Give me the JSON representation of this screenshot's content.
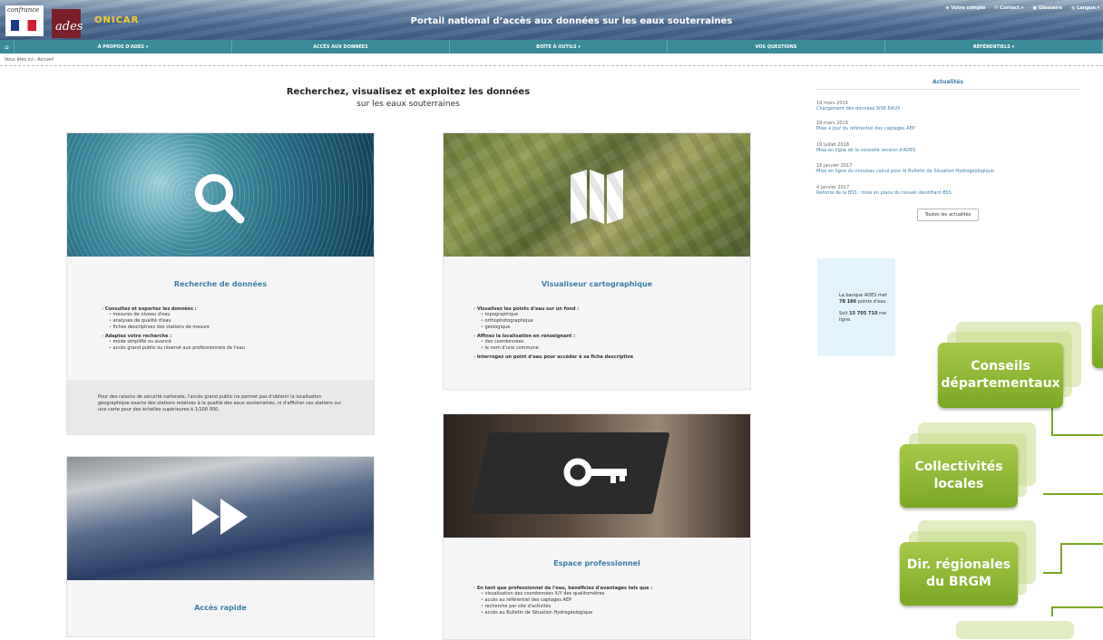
{
  "header": {
    "logo_france": "confrance",
    "logo_ades": "ades",
    "logo_onicar": "ONICAR",
    "portal_title": "Portail national d’accès aux données sur les eaux souterraines",
    "util": [
      "Votre compte",
      "Contact ▾",
      "Glossaire",
      "Langue ▾"
    ]
  },
  "nav": {
    "items": [
      "À PROPOS D'ADES ▾",
      "ACCÈS AUX DONNÉES",
      "BOÎTE À OUTILS ▾",
      "VOS QUESTIONS",
      "RÉFÉRENTIELS ▾"
    ]
  },
  "breadcrumb": "Vous êtes ici : Accueil",
  "main": {
    "title": "Recherchez, visualisez et exploitez les données",
    "subtitle": "sur les eaux souterraines"
  },
  "cards": {
    "recherche": {
      "title": "Recherche de données",
      "g1": "Consultez et exportez les données :",
      "g1_items": [
        "mesures de niveau d'eau",
        "analyses de qualité d'eau",
        "fiches descriptives des stations de mesure"
      ],
      "g2": "Adaptez votre recherche :",
      "g2_items": [
        "mode simplifié ou avancé",
        "accès grand public ou réservé aux professionnels de l'eau"
      ],
      "note": "Pour des raisons de sécurité nationale, l'accès grand public ne permet pas d'obtenir la localisation géographique exacte des stations relatives à la qualité des eaux souterraines, ni d'afficher ces stations sur une carte pour des échelles supérieures à 1/100 000."
    },
    "visu": {
      "title": "Visualiseur cartographique",
      "g1": "Visualisez les points d'eau sur un fond :",
      "g1_items": [
        "topographique",
        "orthophotographique",
        "géologique"
      ],
      "g2": "Affinez la localisation en renseignant :",
      "g2_items": [
        "des coordonnées",
        "le nom d'une commune"
      ],
      "g3": "Interrogez un point d'eau pour accéder à sa fiche descriptive"
    },
    "rapide": {
      "title": "Accès rapide"
    },
    "pro": {
      "title": "Espace professionnel",
      "g1": "En tant que professionnel de l'eau, bénéficiez d'avantages tels que :",
      "g1_items": [
        "visualisation des coordonnées X/Y des qualitomètres",
        "accès au référentiel des captages AEP",
        "recherche par site d'activités",
        "accès au Bulletin de Situation Hydrogéologique"
      ]
    }
  },
  "sidebar": {
    "title": "Actualités",
    "news": [
      {
        "date": "19 mars 2019",
        "text": "Chargement des données SISE-EAUX"
      },
      {
        "date": "19 mars 2019",
        "text": "Mise à jour du référentiel des captages AEP"
      },
      {
        "date": "19 juillet 2018",
        "text": "Mise en ligne de la nouvelle version d'ADES"
      },
      {
        "date": "16 janvier 2017",
        "text": "Mise en ligne du nouveau calcul pour le Bulletin de Situation Hydrogéologique"
      },
      {
        "date": "4 janvier 2017",
        "text": "Refonte de la BSS : mise en place du nouvel identifiant BSS"
      }
    ],
    "all_news_button": "Toutes les actualités",
    "stats": {
      "l1": "La banque ADES met",
      "l2_num": "78 186",
      "l2_rest": " points d'eau",
      "l3_pre": "Soit ",
      "l3_num": "15 705 710",
      "l3_rest": " me",
      "l4": "ligne."
    }
  },
  "org_chart": {
    "boxes": [
      "Conseils départementaux",
      "Collectivités locales",
      "Dir. régionales du BRGM"
    ],
    "line_color": "#7aa824",
    "box_color": "#8cb832"
  }
}
